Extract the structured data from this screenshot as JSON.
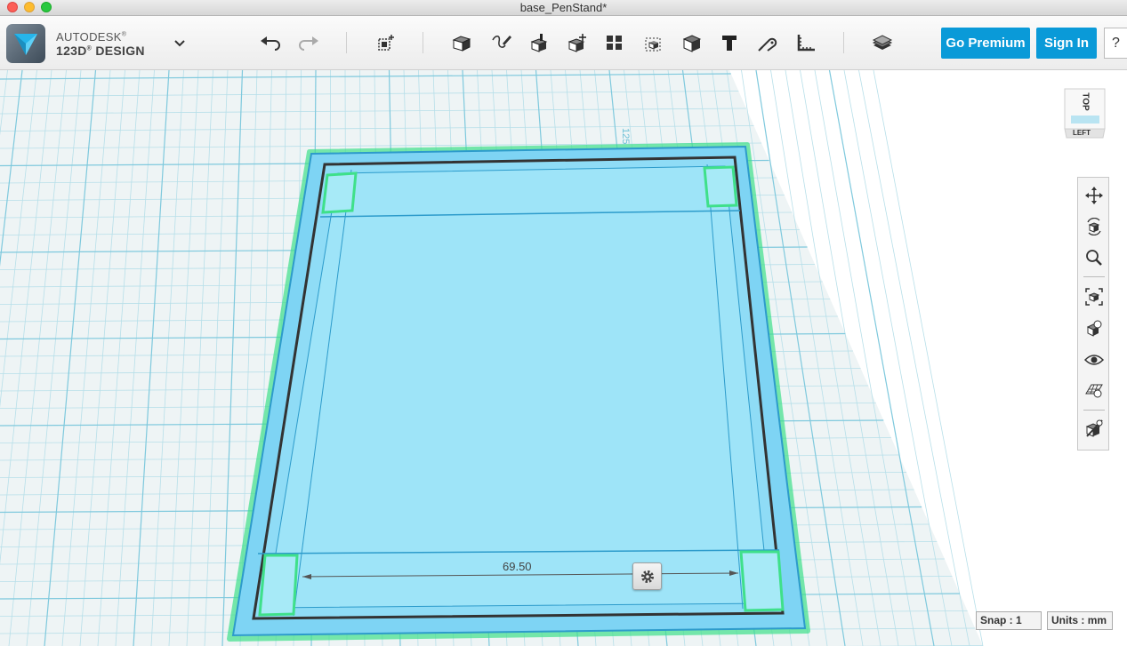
{
  "window": {
    "title": "base_PenStand*"
  },
  "brand": {
    "line1": "AUTODESK",
    "reg1": "®",
    "line2": "123D",
    "reg2": "®",
    "line3": "DESIGN"
  },
  "toolbar": {
    "icons": [
      "undo-icon",
      "redo-icon",
      "primitives-icon",
      "sketch-icon",
      "construct-icon",
      "modify-icon",
      "pattern-icon",
      "grouping-icon",
      "combine-icon",
      "measure-icon",
      "text-icon",
      "snap-icon",
      "ruler-icon",
      "material-icon"
    ]
  },
  "account": {
    "premium_label": "Go Premium",
    "signin_label": "Sign In",
    "help_label": "?"
  },
  "viewcube": {
    "top_label": "TOP",
    "left_label": "LEFT"
  },
  "grid": {
    "ruler_label": "125"
  },
  "navbar": {
    "icons": [
      "pan-icon",
      "orbit-icon",
      "zoom-icon",
      "fit-icon",
      "view-mode-icon",
      "visibility-icon",
      "grid-material-icon",
      "hide-icon"
    ]
  },
  "dimension": {
    "value": "69.50"
  },
  "status": {
    "snap_label": "Snap :",
    "snap_value": "1",
    "units_label": "Units :",
    "units_value": "mm"
  },
  "colors": {
    "accent": "#0a9ad8",
    "grid_bg": "#f0f5f6",
    "grid_line": "#b5dde8",
    "model_fill": "#79d2f4",
    "selection": "#3fe08a"
  }
}
